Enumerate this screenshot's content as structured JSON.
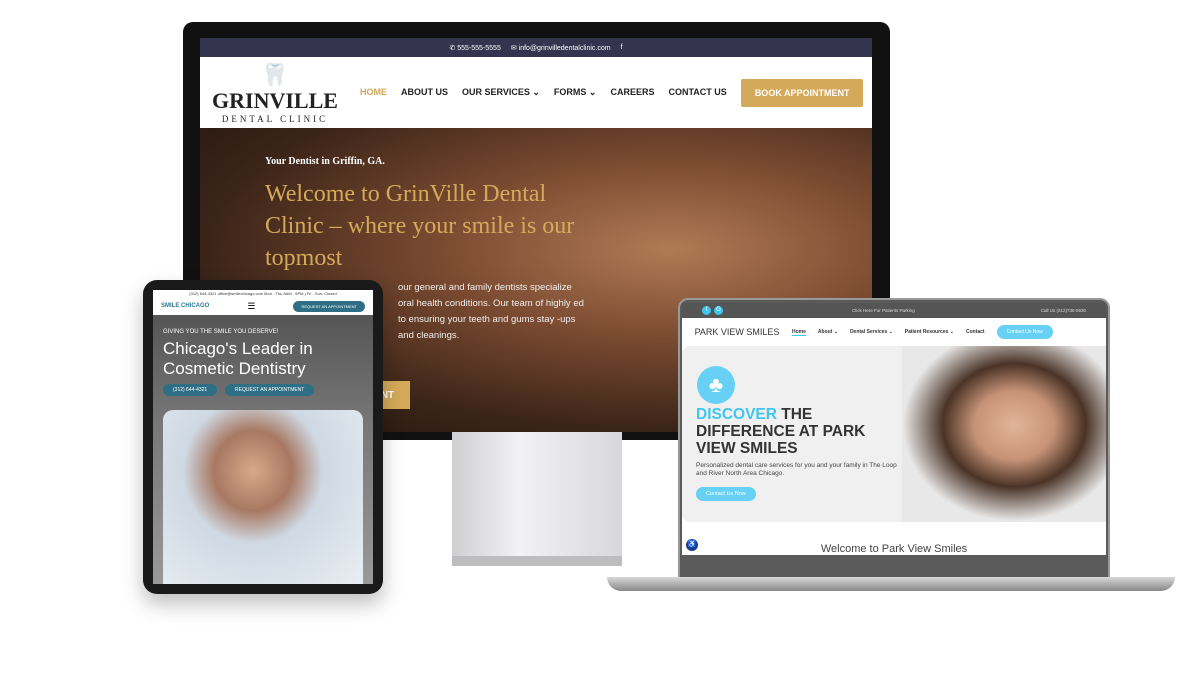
{
  "desktop_site": {
    "topbar": {
      "phone": "555-555-5555",
      "email": "info@grinvilledentalclinic.com",
      "social": "f"
    },
    "logo": {
      "name": "GRINVILLE",
      "tagline": "DENTAL CLINIC"
    },
    "nav": [
      "HOME",
      "ABOUT US",
      "OUR SERVICES ⌄",
      "FORMS ⌄",
      "CAREERS",
      "CONTACT US"
    ],
    "book_button": "BOOK APPOINTMENT",
    "hero": {
      "subtitle": "Your Dentist in Griffin, GA.",
      "title": "Welcome to GrinVille Dental Clinic – where your smile is our topmost",
      "body": "our general and family dentists specialize oral health conditions. Our team of highly ed to ensuring your teeth and gums stay -ups and cleanings.",
      "cta": "NT"
    },
    "accent": "#d4aa5a"
  },
  "tablet_site": {
    "topbar": "(312) 644-4321  office@smilechicago.com  Mon - Thu 8AM - 5PM | Fri - Sun: Closed",
    "logo": "SMILE CHICAGO",
    "request_button": "REQUEST AN APPOINTMENT",
    "hero": {
      "tagline": "GIVING YOU THE SMILE YOU DESERVE!",
      "title": "Chicago's Leader in Cosmetic Dentistry",
      "phone_button": "(312) 644-4321",
      "request_button": "REQUEST AN APPOINTMENT"
    }
  },
  "laptop_site": {
    "topbar": {
      "parking": "Click Here For Patients Parking",
      "call": "Call Us (312)736-5930"
    },
    "logo": "PARK VIEW SMILES",
    "nav": [
      "Home",
      "About ⌄",
      "Dental Services ⌄",
      "Patient Resources ⌄",
      "Contact"
    ],
    "contact_button": "Contact Us Now",
    "hero": {
      "title_highlight": "DISCOVER",
      "title_rest": " THE DIFFERENCE AT PARK VIEW SMILES",
      "body": "Personalized dental care services for you and your family in The Loop and River North Area Chicago.",
      "button": "Contact Us Now"
    },
    "welcome": "Welcome to Park View Smiles",
    "accent": "#3ec6f0"
  }
}
